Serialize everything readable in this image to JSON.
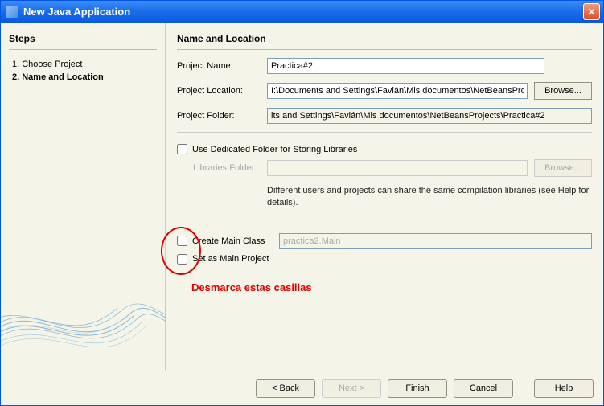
{
  "window": {
    "title": "New Java Application"
  },
  "sidebar": {
    "heading": "Steps",
    "steps": [
      {
        "label": "Choose Project",
        "current": false
      },
      {
        "label": "Name and Location",
        "current": true
      }
    ]
  },
  "main": {
    "heading": "Name and Location",
    "projectName": {
      "label": "Project Name:",
      "value": "Practica#2"
    },
    "projectLocation": {
      "label": "Project Location:",
      "value": "I:\\Documents and Settings\\Favián\\Mis documentos\\NetBeansProjects",
      "browse": "Browse..."
    },
    "projectFolder": {
      "label": "Project Folder:",
      "value": "its and Settings\\Favián\\Mis documentos\\NetBeansProjects\\Practica#2"
    },
    "dedicatedFolder": {
      "label": "Use Dedicated Folder for Storing Libraries",
      "librariesLabel": "Libraries Folder:",
      "librariesValue": "",
      "browse": "Browse...",
      "hint": "Different users and projects can share the same compilation libraries (see Help for details)."
    },
    "createMainClass": {
      "label": "Create Main Class",
      "value": "practica2.Main"
    },
    "setMainProject": {
      "label": "Set as Main Project"
    },
    "annotation": "Desmarca estas casillas"
  },
  "buttons": {
    "back": "< Back",
    "next": "Next >",
    "finish": "Finish",
    "cancel": "Cancel",
    "help": "Help"
  }
}
